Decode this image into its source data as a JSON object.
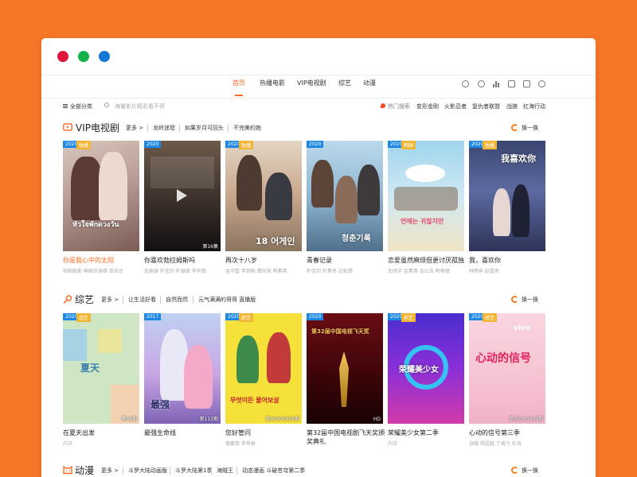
{
  "nav": {
    "tabs": [
      "首页",
      "热播电影",
      "VIP电视剧",
      "综艺",
      "动漫"
    ],
    "active": 0,
    "icons": [
      "clock-icon",
      "message-icon",
      "chart-icon",
      "cube-icon",
      "box-icon",
      "user-icon"
    ]
  },
  "subbar": {
    "all_categories": "全部分类",
    "search_placeholder": "海量影片精彩看不停",
    "hot_label": "热门搜索",
    "hot_items": [
      "变形金刚",
      "火影忍者",
      "复仇者联盟",
      "战狼",
      "红海行动"
    ]
  },
  "sections": [
    {
      "title": "VIP电视剧",
      "more": "更多",
      "links": [
        "龙岭迷窟",
        "如果岁月可回头",
        "不完美的她"
      ],
      "refresh": "换一换",
      "cards": [
        {
          "year": "2020",
          "tag": "独播",
          "title": "你是我心中的太阳",
          "sub": "帕帕勒斯·蒂娜沃洛维 亚尚达",
          "ep": "",
          "poster_text": "หัวใจพักดวงวัน",
          "highlight": true
        },
        {
          "year": "2020",
          "tag": "",
          "title": "你喜欢勃拉姆斯吗",
          "sub": "金高银 朴宝剑 朴银斌 李有镇",
          "ep": "第16集",
          "poster_text": "",
          "highlight": false
        },
        {
          "year": "2020",
          "tag": "独播",
          "title": "再次十八岁",
          "sub": "金河皙 李到晛 魏化俊 韩素希",
          "ep": "",
          "poster_text": "18 어게인",
          "highlight": false
        },
        {
          "year": "2020",
          "tag": "",
          "title": "青春记录",
          "sub": "朴宝剑 朴素丹 边佑锡",
          "ep": "",
          "poster_text": "청춘기록",
          "highlight": false
        },
        {
          "year": "2020",
          "tag": "韩国",
          "title": "恋爱虽然麻烦但更讨厌孤独",
          "sub": "加贤宇 金素惠 金山浩 韩侑镇",
          "ep": "",
          "poster_text": "연애는 귀찮지만",
          "highlight": false
        },
        {
          "year": "2020",
          "tag": "独播",
          "title": "我，喜欢你",
          "sub": "林雨申 赵露思",
          "ep": "",
          "poster_text": "我喜欢你",
          "highlight": false
        }
      ]
    },
    {
      "title": "综艺",
      "more": "更多",
      "links": [
        "让生活好看",
        "自然而然",
        "元气满满的哥哥 直播版"
      ],
      "refresh": "换一换",
      "cards": [
        {
          "year": "2020",
          "tag": "综艺",
          "title": "在夏天出发",
          "sub": "内详",
          "ep": "第01期",
          "poster_text": "夏天",
          "highlight": false
        },
        {
          "year": "2017",
          "tag": "",
          "title": "最强生命线",
          "sub": "",
          "ep": "第113期",
          "poster_text": "最强",
          "highlight": false
        },
        {
          "year": "2020",
          "tag": "综艺",
          "title": "您好管问",
          "sub": "德蒙歌 李寿根",
          "ep": "第20200928期",
          "poster_text": "무엇이든 물어보살",
          "highlight": false
        },
        {
          "year": "2020",
          "tag": "",
          "title": "第32届中国电视剧飞天奖颁奖典礼",
          "sub": "",
          "ep": "HD",
          "poster_text": "第32届中国电视飞天奖",
          "highlight": false
        },
        {
          "year": "2020",
          "tag": "综艺",
          "title": "荣耀美少女第二季",
          "sub": "内详",
          "ep": "",
          "poster_text": "荣耀美少女",
          "highlight": false
        },
        {
          "year": "2020",
          "tag": "综艺",
          "title": "心动的信号第三季",
          "sub": "张翰 杨超越 丁禹兮 杜海",
          "ep": "第20200929期",
          "poster_text": "心动的信号",
          "highlight": false
        }
      ]
    },
    {
      "title": "动漫",
      "more": "更多",
      "links": [
        "斗罗大陆动画版",
        "斗罗大陆第1季",
        "海贼王",
        "动态漫画 斗破苍穹第二季"
      ],
      "refresh": "换一换"
    }
  ],
  "colors": {
    "background": "#F77728",
    "accent": "#FF6A22",
    "year_badge": "#1E88E5",
    "tag_badge": "#F2B636"
  }
}
